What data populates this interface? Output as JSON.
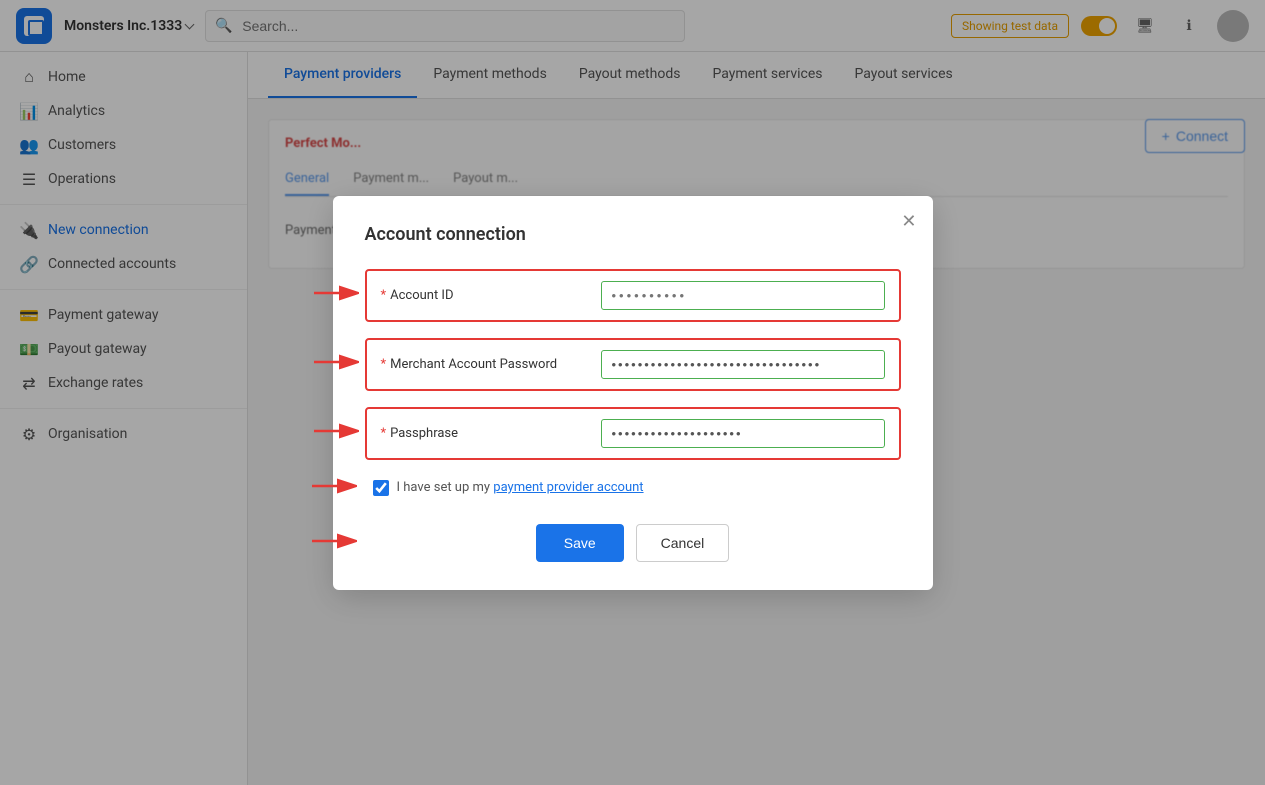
{
  "app": {
    "org_name": "Monsters Inc.1333",
    "logo_alt": "App Logo"
  },
  "topbar": {
    "search_placeholder": "Search...",
    "test_data_label": "Showing test data",
    "monitor_icon": "monitor",
    "info_icon": "info",
    "avatar_alt": "User Avatar"
  },
  "sidebar": {
    "items": [
      {
        "id": "home",
        "label": "Home",
        "icon": "⌂",
        "active": false
      },
      {
        "id": "analytics",
        "label": "Analytics",
        "icon": "📊",
        "active": false
      },
      {
        "id": "customers",
        "label": "Customers",
        "icon": "👥",
        "active": false
      },
      {
        "id": "operations",
        "label": "Operations",
        "icon": "☰",
        "active": false
      }
    ],
    "section2": [
      {
        "id": "new-connection",
        "label": "New connection",
        "icon": "🔌",
        "active": true
      },
      {
        "id": "connected-accounts",
        "label": "Connected accounts",
        "icon": "🔗",
        "active": false
      }
    ],
    "section3": [
      {
        "id": "payment-gateway",
        "label": "Payment gateway",
        "icon": "💳",
        "active": false
      },
      {
        "id": "payout-gateway",
        "label": "Payout gateway",
        "icon": "💵",
        "active": false
      },
      {
        "id": "exchange-rates",
        "label": "Exchange rates",
        "icon": "⇄",
        "active": false
      }
    ],
    "section4": [
      {
        "id": "organisation",
        "label": "Organisation",
        "icon": "⚙",
        "active": false
      }
    ]
  },
  "nav_tabs": [
    {
      "id": "payment-providers",
      "label": "Payment providers",
      "active": true
    },
    {
      "id": "payment-methods",
      "label": "Payment methods",
      "active": false
    },
    {
      "id": "payout-methods",
      "label": "Payout methods",
      "active": false
    },
    {
      "id": "payment-services",
      "label": "Payment services",
      "active": false
    },
    {
      "id": "payout-services",
      "label": "Payout services",
      "active": false
    }
  ],
  "connect_button": "+ Connect",
  "provider": {
    "logo_text": "Perfect Mo...",
    "tabs": [
      "General",
      "Payment m...",
      "Payout m..."
    ],
    "active_tab": "General"
  },
  "modal": {
    "title": "Account connection",
    "fields": [
      {
        "id": "account-id",
        "label": "Account ID",
        "required": true,
        "value": "",
        "placeholder": "••••••••••",
        "type": "text"
      },
      {
        "id": "merchant-account-password",
        "label": "Merchant Account Password",
        "required": true,
        "value": "••••••••••••••••••••••••••••••••",
        "placeholder": "",
        "type": "password"
      },
      {
        "id": "passphrase",
        "label": "Passphrase",
        "required": true,
        "value": "••••••••••••••••••••",
        "placeholder": "",
        "type": "password"
      }
    ],
    "checkbox": {
      "label_prefix": "I have set up my ",
      "link_text": "payment provider account",
      "checked": true
    },
    "save_label": "Save",
    "cancel_label": "Cancel"
  }
}
